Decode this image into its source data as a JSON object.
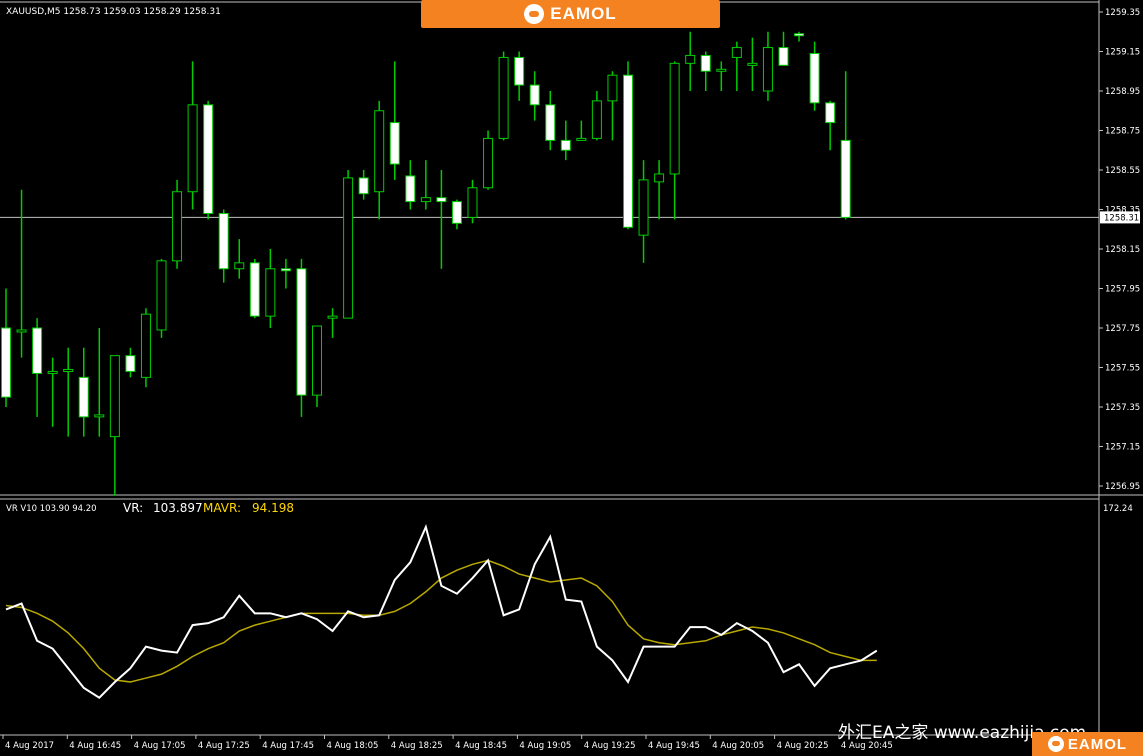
{
  "header": {
    "symbol_ohlc": "XAUUSD,M5  1258.73 1259.03 1258.29 1258.31",
    "brand": "EAMOL"
  },
  "indicator": {
    "short_name": "VR V10 103.90 94.20",
    "vr_label": "VR:",
    "vr_value": "103.897",
    "mavr_label": "MAVR:",
    "mavr_value": "94.198",
    "top_label": "172.24"
  },
  "price_axis": {
    "ticks": [
      "1259.35",
      "1259.15",
      "1258.95",
      "1258.75",
      "1258.55",
      "1258.35",
      "1258.15",
      "1257.95",
      "1257.75",
      "1257.55",
      "1257.35",
      "1257.15",
      "1256.95"
    ],
    "current_price": "1258.31"
  },
  "time_axis": {
    "labels": [
      "4 Aug 2017",
      "4 Aug 16:45",
      "4 Aug 17:05",
      "4 Aug 17:25",
      "4 Aug 17:45",
      "4 Aug 18:05",
      "4 Aug 18:25",
      "4 Aug 18:45",
      "4 Aug 19:05",
      "4 Aug 19:25",
      "4 Aug 19:45",
      "4 Aug 20:05",
      "4 Aug 20:25",
      "4 Aug 20:45"
    ]
  },
  "watermark": {
    "site": "外汇EA之家 www.eazhijia.com",
    "brand": "EAMOL"
  },
  "colors": {
    "bull": "#00cc00",
    "bear_body": "#ffffff",
    "vr_line": "#ffffff",
    "mavr_line": "#b8a800",
    "mavr_text": "#ffd700",
    "banner": "#f58220",
    "grid_line": "#c0c0c0"
  },
  "chart_data": [
    {
      "type": "candlestick",
      "title": "XAUUSD,M5",
      "ylim": [
        1256.9,
        1259.4
      ],
      "candles": [
        {
          "o": 1257.75,
          "h": 1257.95,
          "l": 1257.35,
          "c": 1257.4
        },
        {
          "o": 1257.73,
          "h": 1258.45,
          "l": 1257.6,
          "c": 1257.74
        },
        {
          "o": 1257.75,
          "h": 1257.8,
          "l": 1257.3,
          "c": 1257.52
        },
        {
          "o": 1257.52,
          "h": 1257.6,
          "l": 1257.25,
          "c": 1257.53
        },
        {
          "o": 1257.53,
          "h": 1257.65,
          "l": 1257.2,
          "c": 1257.54
        },
        {
          "o": 1257.5,
          "h": 1257.65,
          "l": 1257.2,
          "c": 1257.3
        },
        {
          "o": 1257.3,
          "h": 1257.75,
          "l": 1257.2,
          "c": 1257.31
        },
        {
          "o": 1257.2,
          "h": 1257.6,
          "l": 1256.9,
          "c": 1257.61
        },
        {
          "o": 1257.61,
          "h": 1257.65,
          "l": 1257.5,
          "c": 1257.53
        },
        {
          "o": 1257.5,
          "h": 1257.85,
          "l": 1257.45,
          "c": 1257.82
        },
        {
          "o": 1257.74,
          "h": 1258.1,
          "l": 1257.7,
          "c": 1258.09
        },
        {
          "o": 1258.09,
          "h": 1258.5,
          "l": 1258.05,
          "c": 1258.44
        },
        {
          "o": 1258.44,
          "h": 1259.1,
          "l": 1258.35,
          "c": 1258.88
        },
        {
          "o": 1258.88,
          "h": 1258.9,
          "l": 1258.3,
          "c": 1258.33
        },
        {
          "o": 1258.33,
          "h": 1258.35,
          "l": 1257.98,
          "c": 1258.05
        },
        {
          "o": 1258.05,
          "h": 1258.2,
          "l": 1258.0,
          "c": 1258.08
        },
        {
          "o": 1258.08,
          "h": 1258.1,
          "l": 1257.8,
          "c": 1257.81
        },
        {
          "o": 1257.81,
          "h": 1258.15,
          "l": 1257.75,
          "c": 1258.05
        },
        {
          "o": 1258.05,
          "h": 1258.1,
          "l": 1257.95,
          "c": 1258.04
        },
        {
          "o": 1258.05,
          "h": 1258.1,
          "l": 1257.3,
          "c": 1257.41
        },
        {
          "o": 1257.41,
          "h": 1257.75,
          "l": 1257.35,
          "c": 1257.76
        },
        {
          "o": 1257.8,
          "h": 1257.85,
          "l": 1257.7,
          "c": 1257.81
        },
        {
          "o": 1257.8,
          "h": 1258.55,
          "l": 1257.8,
          "c": 1258.51
        },
        {
          "o": 1258.51,
          "h": 1258.55,
          "l": 1258.4,
          "c": 1258.43
        },
        {
          "o": 1258.44,
          "h": 1258.9,
          "l": 1258.3,
          "c": 1258.85
        },
        {
          "o": 1258.79,
          "h": 1259.1,
          "l": 1258.5,
          "c": 1258.58
        },
        {
          "o": 1258.52,
          "h": 1258.6,
          "l": 1258.35,
          "c": 1258.39
        },
        {
          "o": 1258.39,
          "h": 1258.6,
          "l": 1258.35,
          "c": 1258.41
        },
        {
          "o": 1258.41,
          "h": 1258.55,
          "l": 1258.05,
          "c": 1258.39
        },
        {
          "o": 1258.39,
          "h": 1258.4,
          "l": 1258.25,
          "c": 1258.28
        },
        {
          "o": 1258.31,
          "h": 1258.5,
          "l": 1258.28,
          "c": 1258.46
        },
        {
          "o": 1258.46,
          "h": 1258.75,
          "l": 1258.45,
          "c": 1258.71
        },
        {
          "o": 1258.71,
          "h": 1259.15,
          "l": 1258.7,
          "c": 1259.12
        },
        {
          "o": 1259.12,
          "h": 1259.15,
          "l": 1258.9,
          "c": 1258.98
        },
        {
          "o": 1258.98,
          "h": 1259.05,
          "l": 1258.8,
          "c": 1258.88
        },
        {
          "o": 1258.88,
          "h": 1258.95,
          "l": 1258.65,
          "c": 1258.7
        },
        {
          "o": 1258.7,
          "h": 1258.8,
          "l": 1258.6,
          "c": 1258.65
        },
        {
          "o": 1258.7,
          "h": 1258.8,
          "l": 1258.7,
          "c": 1258.71
        },
        {
          "o": 1258.71,
          "h": 1258.95,
          "l": 1258.7,
          "c": 1258.9
        },
        {
          "o": 1258.9,
          "h": 1259.05,
          "l": 1258.7,
          "c": 1259.03
        },
        {
          "o": 1259.03,
          "h": 1259.1,
          "l": 1258.25,
          "c": 1258.26
        },
        {
          "o": 1258.22,
          "h": 1258.6,
          "l": 1258.08,
          "c": 1258.5
        },
        {
          "o": 1258.49,
          "h": 1258.6,
          "l": 1258.3,
          "c": 1258.53
        },
        {
          "o": 1258.53,
          "h": 1259.1,
          "l": 1258.3,
          "c": 1259.09
        },
        {
          "o": 1259.09,
          "h": 1259.25,
          "l": 1258.95,
          "c": 1259.13
        },
        {
          "o": 1259.13,
          "h": 1259.15,
          "l": 1258.95,
          "c": 1259.05
        },
        {
          "o": 1259.05,
          "h": 1259.1,
          "l": 1258.95,
          "c": 1259.06
        },
        {
          "o": 1259.12,
          "h": 1259.2,
          "l": 1258.95,
          "c": 1259.17
        },
        {
          "o": 1259.08,
          "h": 1259.22,
          "l": 1258.95,
          "c": 1259.09
        },
        {
          "o": 1258.95,
          "h": 1259.25,
          "l": 1258.9,
          "c": 1259.17
        },
        {
          "o": 1259.17,
          "h": 1259.25,
          "l": 1259.08,
          "c": 1259.08
        },
        {
          "o": 1259.24,
          "h": 1259.25,
          "l": 1259.2,
          "c": 1259.23
        },
        {
          "o": 1259.14,
          "h": 1259.2,
          "l": 1258.85,
          "c": 1258.89
        },
        {
          "o": 1258.89,
          "h": 1258.9,
          "l": 1258.65,
          "c": 1258.79
        },
        {
          "o": 1258.7,
          "h": 1259.05,
          "l": 1258.3,
          "c": 1258.31
        }
      ]
    },
    {
      "type": "line",
      "title": "VR V10",
      "ylim": [
        55,
        172.24
      ],
      "series": [
        {
          "name": "VR",
          "values": [
            118,
            121,
            102,
            98,
            88,
            78,
            73,
            81,
            88,
            99,
            97,
            96,
            110,
            111,
            114,
            125,
            116,
            116,
            114,
            116,
            113,
            107,
            117,
            114,
            115,
            133,
            142,
            160,
            130,
            126,
            134,
            143,
            115,
            118,
            141,
            155,
            123,
            122,
            99,
            92,
            81,
            99,
            99,
            99,
            109,
            109,
            105,
            111,
            107,
            101,
            86,
            90,
            79,
            88,
            90,
            92,
            97
          ]
        },
        {
          "name": "MAVR",
          "values": [
            120,
            119,
            116,
            112,
            106,
            98,
            88,
            82,
            81,
            83,
            85,
            89,
            94,
            98,
            101,
            107,
            110,
            112,
            114,
            116,
            116,
            116,
            116,
            115,
            115,
            117,
            121,
            127,
            134,
            138,
            141,
            143,
            140,
            136,
            134,
            132,
            133,
            134,
            130,
            122,
            110,
            103,
            101,
            100,
            101,
            102,
            105,
            107,
            109,
            108,
            106,
            103,
            100,
            96,
            94,
            92,
            92
          ]
        }
      ]
    }
  ]
}
